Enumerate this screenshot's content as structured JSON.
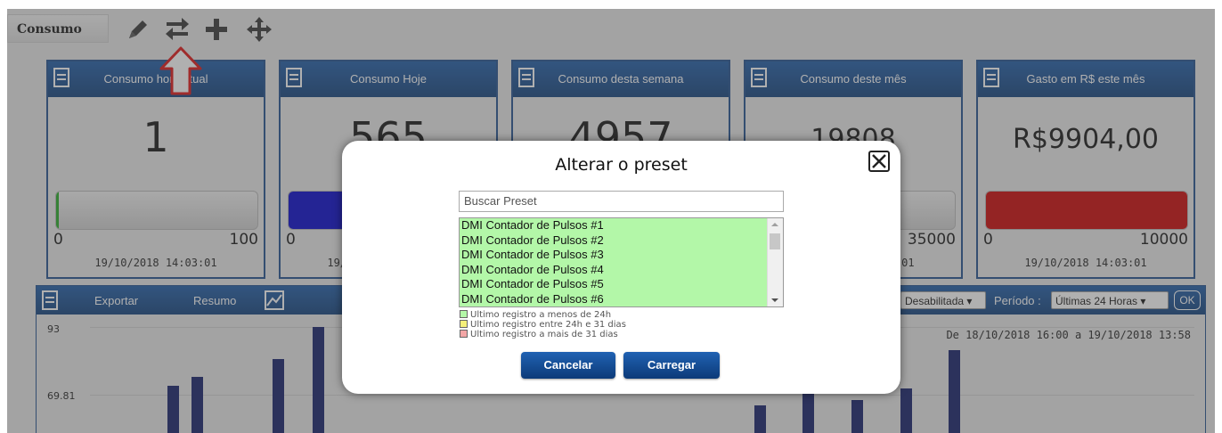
{
  "toolbar": {
    "tab_label": "Consumo",
    "icons": [
      "pencil-icon",
      "swap-arrows-icon",
      "plus-icon",
      "move-arrows-icon"
    ],
    "highlight_arrow": "red-up-arrow"
  },
  "cards": [
    {
      "title": "Consumo hora atual",
      "value": "1",
      "min": "0",
      "max": "100",
      "timestamp": "19/10/2018 14:03:01",
      "fill_fraction": 0.01,
      "fill_color": "#22aa22"
    },
    {
      "title": "Consumo Hoje",
      "value": "565",
      "min": "0",
      "max": "",
      "timestamp": "19/10/2018 14:03:01",
      "fill_color": "#0000cc"
    },
    {
      "title": "Consumo desta semana",
      "value": "4957",
      "min": "",
      "max": "",
      "timestamp": "",
      "fill_color": ""
    },
    {
      "title": "Consumo deste mês",
      "value": "19808",
      "min": "",
      "max": "35000",
      "timestamp": "19/10/2018 14:03:01",
      "fill_color": ""
    },
    {
      "title": "Gasto em R$ este mês",
      "value": "R$9904,00",
      "min": "0",
      "max": "10000",
      "timestamp": "19/10/2018 14:03:01",
      "fill_fraction": 1.0,
      "fill_color": "#cc0000"
    }
  ],
  "panel": {
    "export_label": "Exportar",
    "summary_label": "Resumo",
    "chart_icon": "chart-edit-icon",
    "select_state": "Desabilitada",
    "period_label": "Período :",
    "period_value": "Últimas 24 Horas",
    "ok_label": "OK",
    "date_range": "De 18/10/2018 16:00 a 19/10/2018 13:58"
  },
  "chart_data": {
    "type": "bar",
    "yticks": [
      "93",
      "69.81"
    ],
    "values": [
      73,
      76,
      82,
      93,
      50,
      66,
      70,
      68,
      72,
      85
    ],
    "color": "#0f1a66"
  },
  "modal": {
    "title": "Alterar o preset",
    "search_placeholder": "Buscar Preset",
    "items": [
      "DMI Contador de Pulsos #1",
      "DMI Contador de Pulsos #2",
      "DMI Contador de Pulsos #3",
      "DMI Contador de Pulsos #4",
      "DMI Contador de Pulsos #5",
      "DMI Contador de Pulsos #6"
    ],
    "legend": [
      {
        "color": "#b3f7a8",
        "text": "Ultimo registro a menos de 24h"
      },
      {
        "color": "#f5f07a",
        "text": "Ultimo registro entre 24h e 31 dias"
      },
      {
        "color": "#f3a6a6",
        "text": "Ultimo registro a mais de 31 dias"
      }
    ],
    "cancel_label": "Cancelar",
    "load_label": "Carregar"
  }
}
